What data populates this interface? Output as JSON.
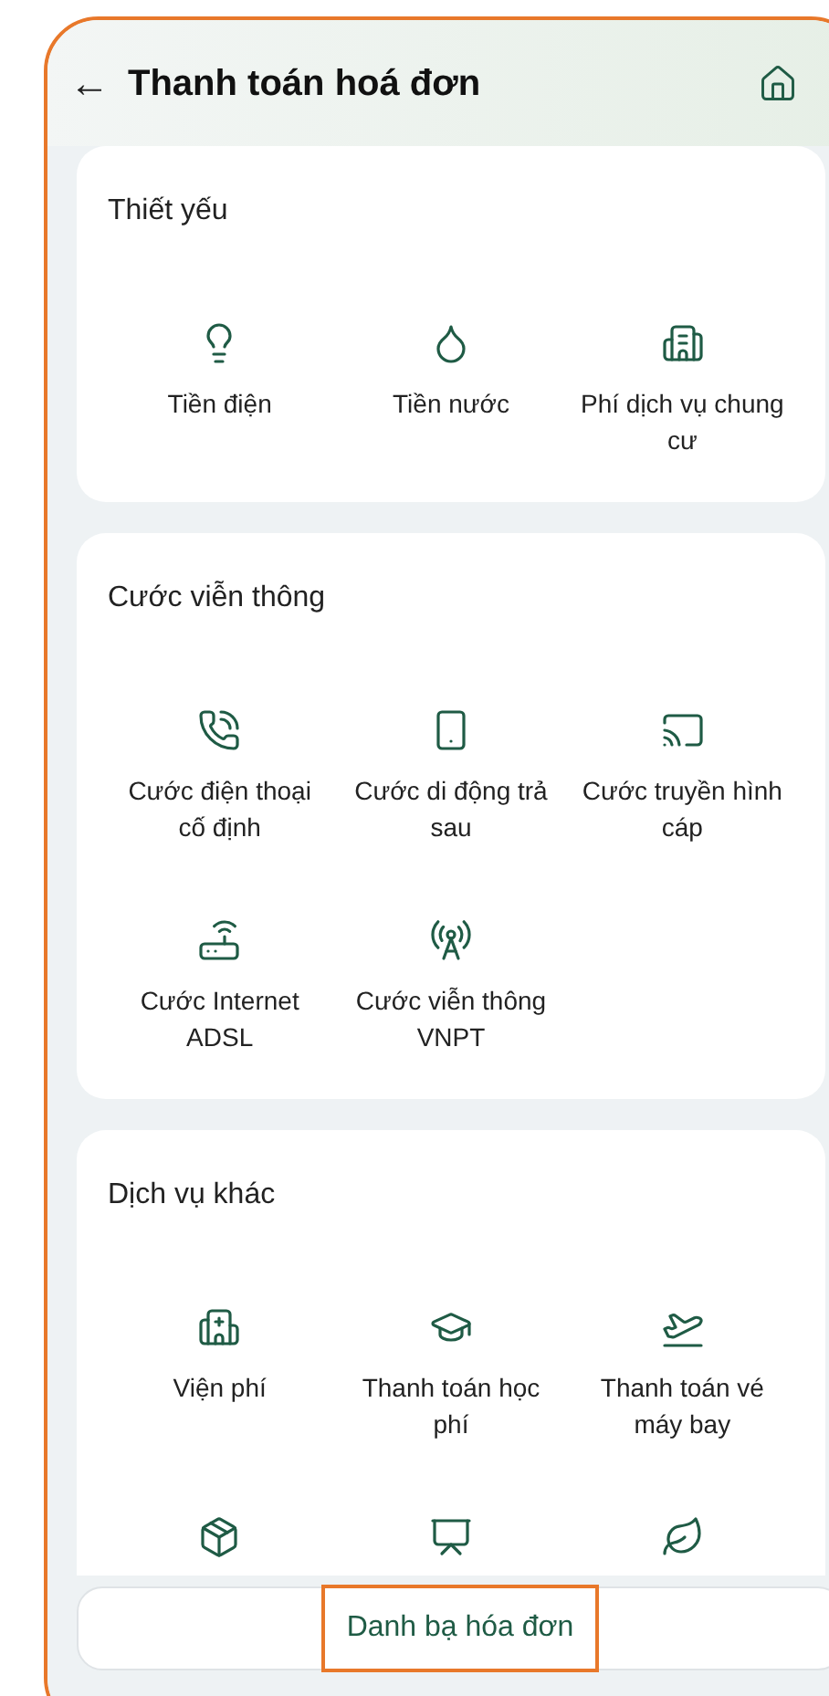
{
  "header": {
    "back": "←",
    "title": "Thanh toán hoá đơn"
  },
  "sections": [
    {
      "title": "Thiết yếu",
      "items": [
        {
          "kind": "bulb",
          "label": "Tiền điện"
        },
        {
          "kind": "drop",
          "label": "Tiền nước"
        },
        {
          "kind": "building",
          "label": "Phí dịch vụ chung cư"
        }
      ]
    },
    {
      "title": "Cước viễn thông",
      "items": [
        {
          "kind": "phone",
          "label": "Cước điện thoại cố định"
        },
        {
          "kind": "mobile",
          "label": "Cước di động trả sau"
        },
        {
          "kind": "cast",
          "label": "Cước truyền hình cáp"
        },
        {
          "kind": "router",
          "label": "Cước Internet ADSL"
        },
        {
          "kind": "tower",
          "label": "Cước viễn thông VNPT"
        }
      ]
    },
    {
      "title": "Dịch vụ khác",
      "items": [
        {
          "kind": "hospital",
          "label": "Viện phí"
        },
        {
          "kind": "cap",
          "label": "Thanh toán học phí"
        },
        {
          "kind": "plane",
          "label": "Thanh toán vé máy bay"
        },
        {
          "kind": "box"
        },
        {
          "kind": "board"
        },
        {
          "kind": "leaf"
        }
      ]
    }
  ],
  "bottom_button": {
    "label": "Danh bạ hóa đơn",
    "highlighted": true
  }
}
